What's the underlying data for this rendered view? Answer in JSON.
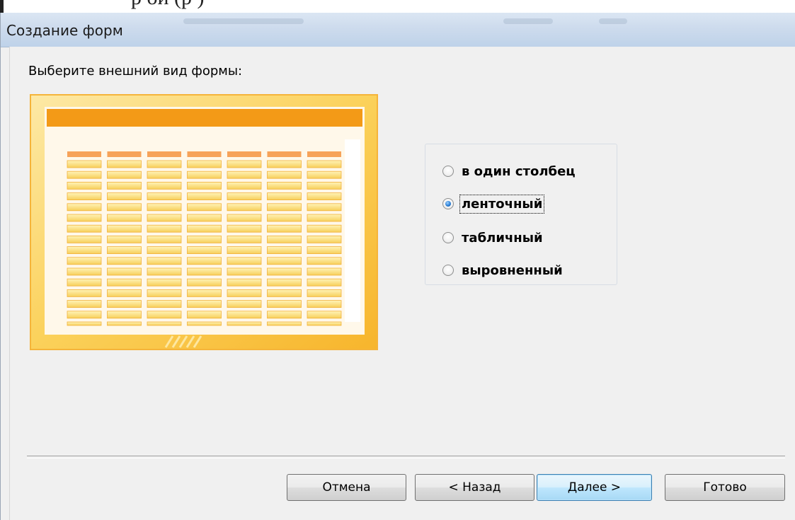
{
  "document_fragment": "р          ой          (р          )",
  "window": {
    "title": "Создание форм"
  },
  "prompt": "Выберите внешний вид формы:",
  "preview": {
    "columns": 7,
    "rows": 16
  },
  "layout_options": [
    {
      "label": "в один столбец",
      "selected": false
    },
    {
      "label": "ленточный",
      "selected": true
    },
    {
      "label": "табличный",
      "selected": false
    },
    {
      "label": "выровненный",
      "selected": false
    }
  ],
  "buttons": {
    "cancel": "Отмена",
    "back": "< Назад",
    "next": "Далее >",
    "finish": "Готово"
  },
  "colors": {
    "accent": "#f5a623",
    "preview_header": "#f39a17",
    "selected_radio": "#2b7fd6"
  }
}
